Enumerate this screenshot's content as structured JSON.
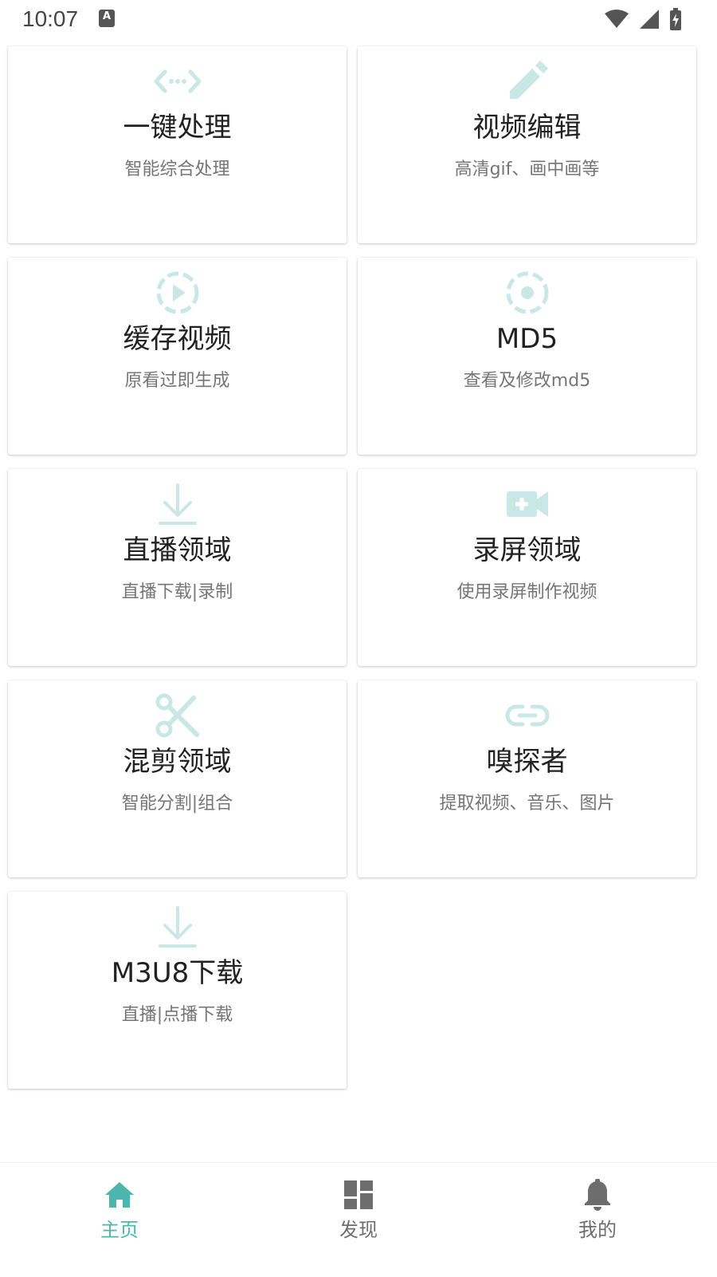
{
  "status_bar": {
    "time": "10:07",
    "badge_letter": "A",
    "icons": [
      "wifi-icon",
      "signal-icon",
      "battery-charging-icon"
    ]
  },
  "colors": {
    "accent": "#4db6ac",
    "icon_light": "#c9e8e5",
    "nav_inactive": "#6d6d6d",
    "title": "#212121",
    "subtitle": "#757575"
  },
  "cards": [
    {
      "title": "一键处理",
      "subtitle": "智能综合处理",
      "icon": "code-arrows-icon"
    },
    {
      "title": "视频编辑",
      "subtitle": "高清gif、画中画等",
      "icon": "pencil-icon"
    },
    {
      "title": "缓存视频",
      "subtitle": "原看过即生成",
      "icon": "play-circle-dashed-icon"
    },
    {
      "title": "MD5",
      "subtitle": "查看及修改md5",
      "icon": "target-dashed-icon"
    },
    {
      "title": "直播领域",
      "subtitle": "直播下载|录制",
      "icon": "download-icon"
    },
    {
      "title": "录屏领域",
      "subtitle": "使用录屏制作视频",
      "icon": "video-add-icon"
    },
    {
      "title": "混剪领域",
      "subtitle": "智能分割|组合",
      "icon": "scissors-icon"
    },
    {
      "title": "嗅探者",
      "subtitle": "提取视频、音乐、图片",
      "icon": "link-icon"
    },
    {
      "title": "M3U8下载",
      "subtitle": "直播|点播下载",
      "icon": "download-icon"
    }
  ],
  "bottom_nav": [
    {
      "label": "主页",
      "icon": "home-icon",
      "active": true
    },
    {
      "label": "发现",
      "icon": "dashboard-icon",
      "active": false
    },
    {
      "label": "我的",
      "icon": "bell-icon",
      "active": false
    }
  ]
}
